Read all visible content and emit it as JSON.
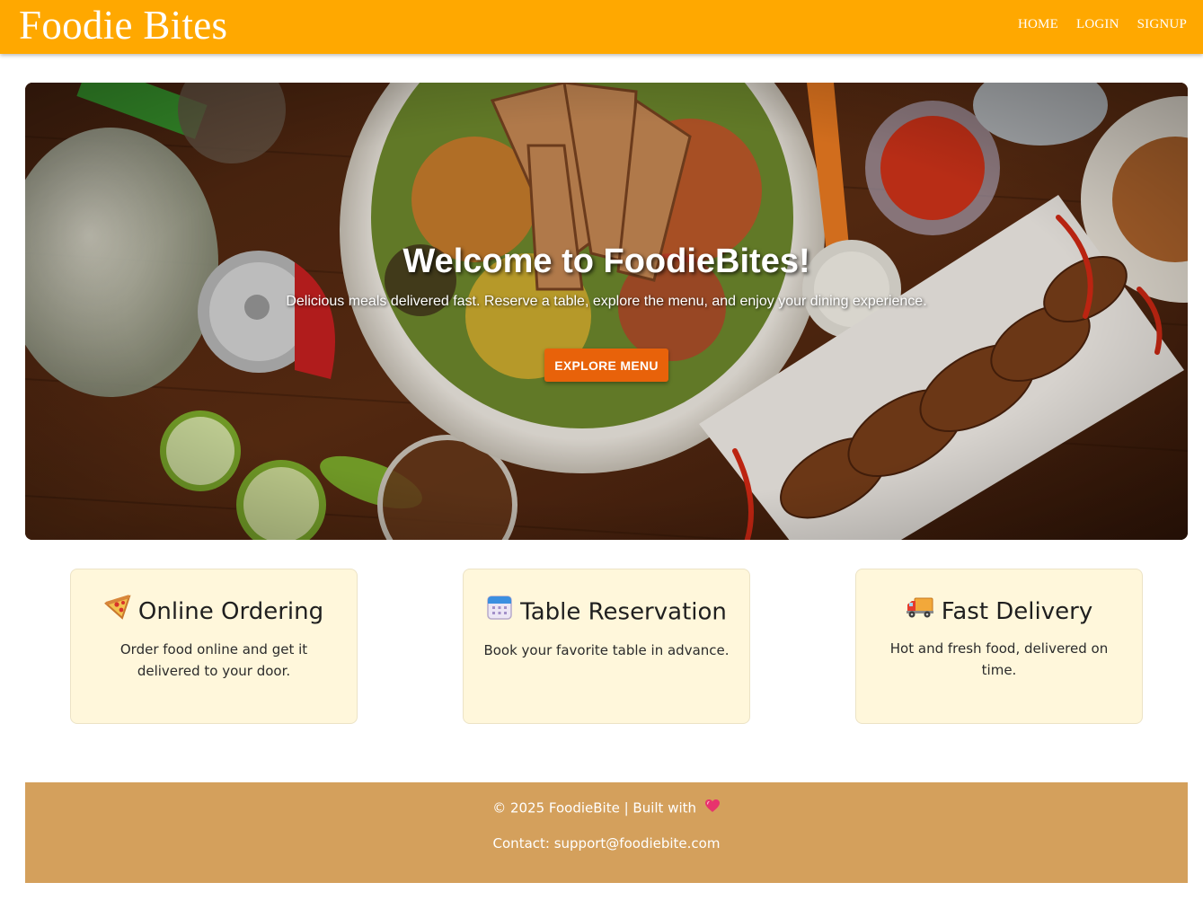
{
  "navbar": {
    "brand": "Foodie Bites",
    "links": [
      "HOME",
      "LOGIN",
      "SIGNUP"
    ]
  },
  "hero": {
    "title": "Welcome to FoodieBites!",
    "subtitle": "Delicious meals delivered fast. Reserve a table, explore the menu, and enjoy your dining experience.",
    "button_label": "EXPLORE MENU",
    "background_image": "food-spread-photo"
  },
  "features": [
    {
      "icon": "pizza-icon",
      "title": "Online Ordering",
      "description": "Order food online and get it delivered to your door."
    },
    {
      "icon": "calendar-icon",
      "title": "Table Reservation",
      "description": "Book your favorite table in advance."
    },
    {
      "icon": "truck-icon",
      "title": "Fast Delivery",
      "description": "Hot and fresh food, delivered on time."
    }
  ],
  "footer": {
    "copyright": "© 2025 FoodieBite | Built with",
    "heart_icon": "heart-icon",
    "contact": "Contact: support@foodiebite.com"
  },
  "colors": {
    "navbar": "#ffa800",
    "button": "#e8620a",
    "card_bg": "#fff7db",
    "footer": "#d4a05c"
  }
}
